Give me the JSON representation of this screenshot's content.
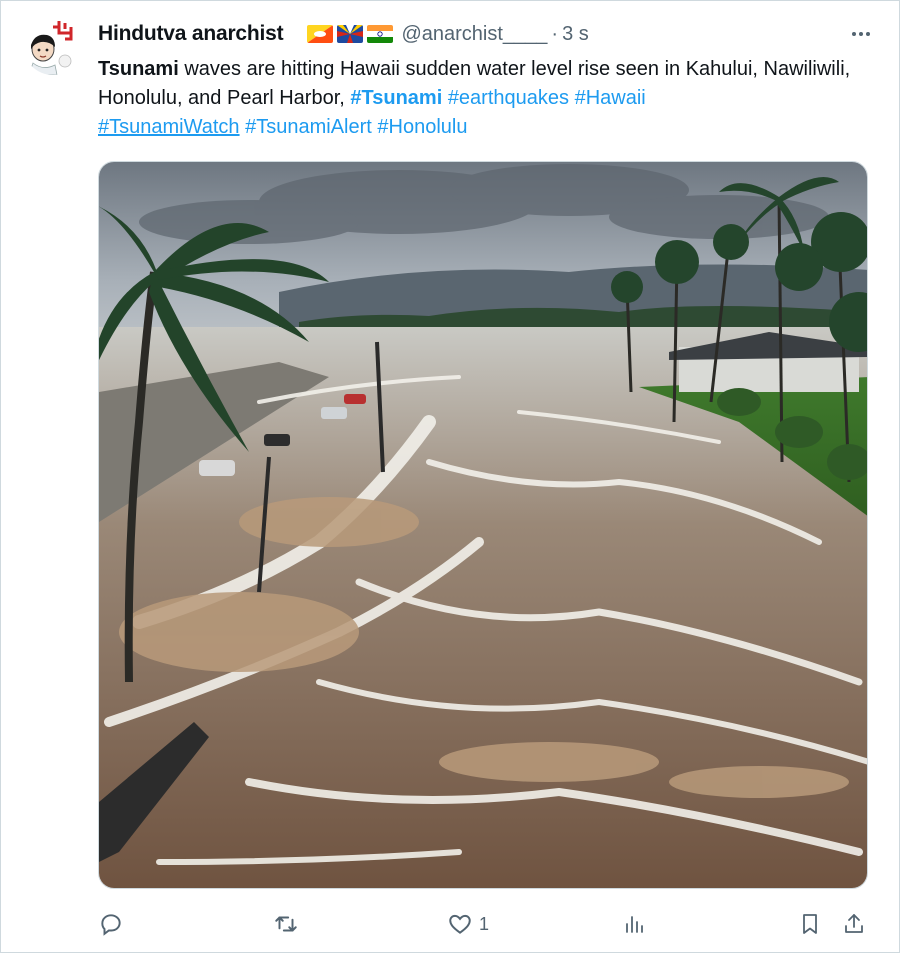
{
  "tweet": {
    "display_name": "Hindutva anarchist",
    "handle": "@anarchist____",
    "separator": "·",
    "timestamp": "3 s",
    "text": {
      "bold_lead": "Tsunami",
      "body": " waves are hitting Hawaii  sudden water level rise seen in Kahului, Nawiliwili, Honolulu, and Pearl Harbor,  ",
      "hashtags": [
        "#Tsunami",
        "#earthquakes",
        "#Hawaii",
        "#TsunamiWatch",
        "#TsunamiAlert",
        "#Honolulu"
      ]
    },
    "flags": [
      "bhutan-flag",
      "reunion-flag",
      "india-flag"
    ],
    "media": {
      "scene": "flooded coastal road with palm trees, brown churning water and overcast sky"
    },
    "actions": {
      "reply_count": "",
      "retweet_count": "",
      "like_count": "1",
      "views_count": ""
    }
  },
  "colors": {
    "link": "#1d9bf0",
    "secondary_text": "#536471",
    "primary_text": "#0f1419",
    "border": "#cfd9de"
  }
}
